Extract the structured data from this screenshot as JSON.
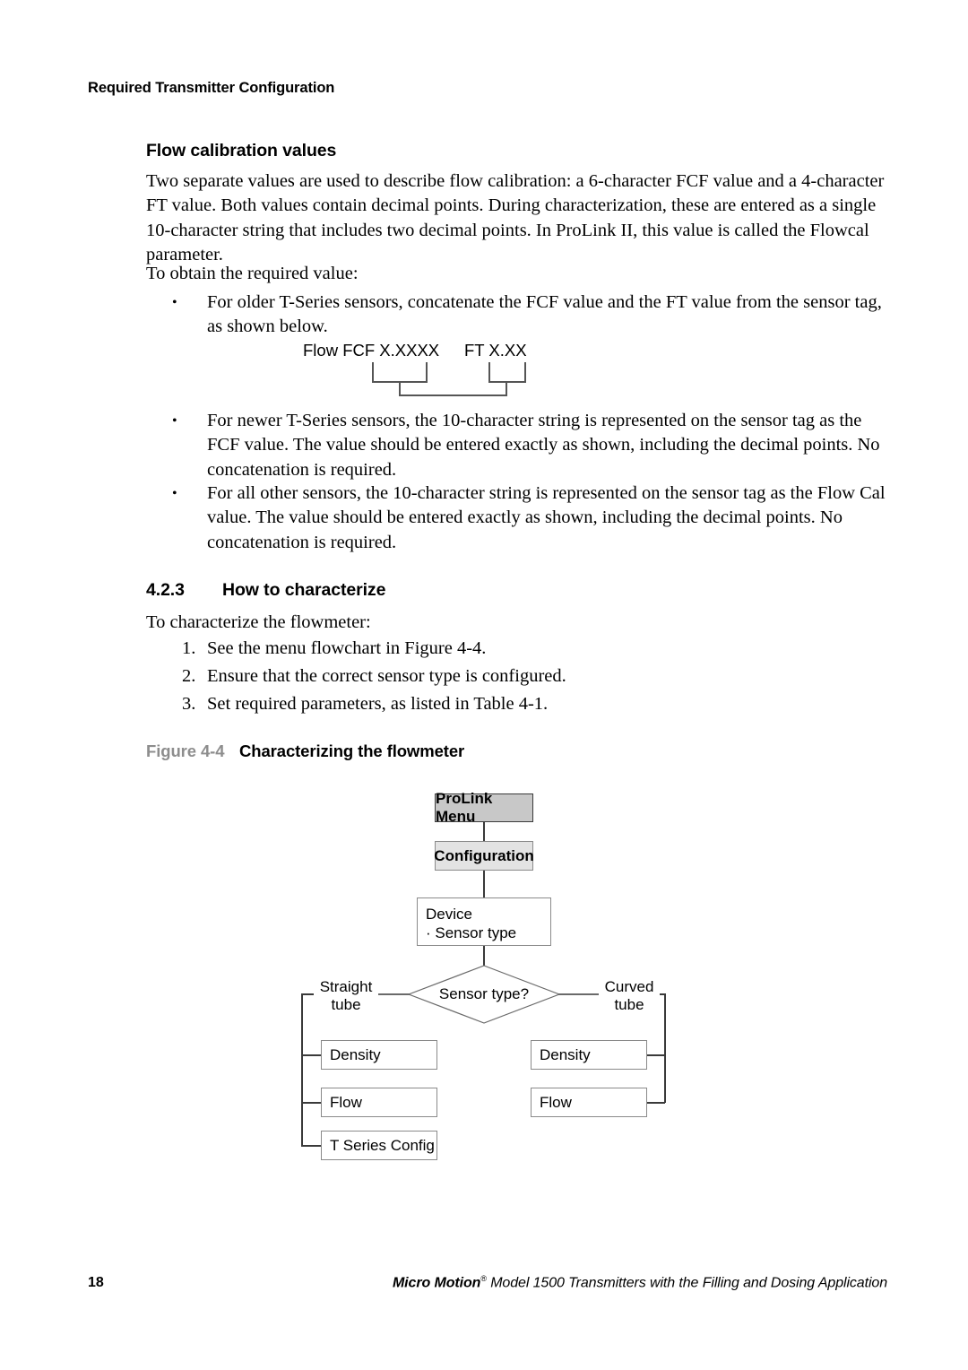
{
  "running_header": "Required Transmitter Configuration",
  "sections": {
    "flow_calibration": {
      "heading": "Flow calibration values",
      "paragraph_1": "Two separate values are used to describe flow calibration: a 6-character FCF value and a 4-character FT value. Both values contain decimal points. During characterization, these are entered as a single 10-character string that includes two decimal points. In ProLink II, this value is called the Flowcal parameter.",
      "paragraph_2": "To obtain the required value:",
      "bullets": [
        "For older T-Series sensors, concatenate the FCF value and the FT value from the sensor tag, as shown below.",
        "For newer T-Series sensors, the 10-character string is represented on the sensor tag as the FCF value. The value should be entered exactly as shown, including the decimal points. No concatenation is required.",
        "For all other sensors, the 10-character string is represented on the sensor tag as the Flow Cal value. The value should be entered exactly as shown, including the decimal points. No concatenation is required."
      ],
      "tag_diagram": {
        "fcf_label": "Flow FCF X.XXXX",
        "ft_label": "FT X.XX"
      }
    },
    "how_to_characterize": {
      "number": "4.2.3",
      "heading": "How to characterize",
      "lead_in": "To characterize the flowmeter:",
      "steps": [
        {
          "n": "1.",
          "text": "See the menu flowchart in Figure 4-4."
        },
        {
          "n": "2.",
          "text": "Ensure that the correct sensor type is configured."
        },
        {
          "n": "3.",
          "text": "Set required parameters, as listed in Table 4-1."
        }
      ]
    }
  },
  "figure": {
    "number": "Figure 4-4",
    "title": "Characterizing the flowmeter",
    "nodes": {
      "prolink_menu": "ProLink Menu",
      "configuration": "Configuration",
      "device_title": "Device",
      "device_item": "· Sensor type",
      "decision": "Sensor type?",
      "left_branch_label_line1": "Straight",
      "left_branch_label_line2": "tube",
      "right_branch_label_line1": "Curved",
      "right_branch_label_line2": "tube",
      "left_density": "Density",
      "left_flow": "Flow",
      "left_tseries": "T Series Config",
      "right_density": "Density",
      "right_flow": "Flow"
    },
    "colors": {
      "node_dark_fill": "#c8c8c8",
      "node_light_fill": "#e3e3e3",
      "node_plain_fill": "#ffffff",
      "connector": "#3a3a3a",
      "figure_number_gray": "#8d8d8d"
    }
  },
  "footer": {
    "page_number": "18",
    "brand": "Micro Motion",
    "registered_mark": "®",
    "rest": " Model 1500 Transmitters with the Filling and Dosing Application"
  }
}
